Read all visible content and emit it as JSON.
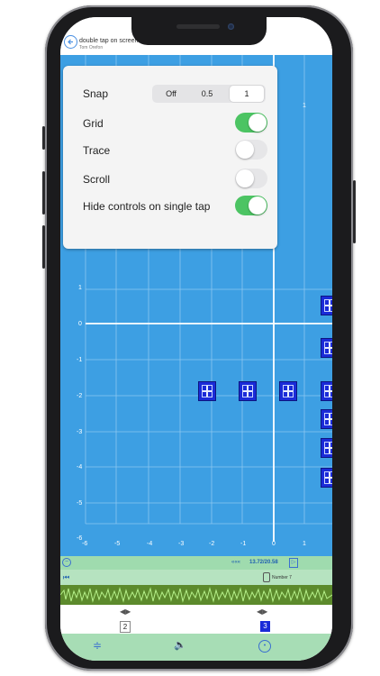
{
  "header": {
    "title": "double tap on screen",
    "subtitle": "Tom Orefon"
  },
  "settings": {
    "snap_label": "Snap",
    "snap_options": [
      "Off",
      "0.5",
      "1"
    ],
    "snap_selected": "1",
    "grid_label": "Grid",
    "grid_on": true,
    "trace_label": "Trace",
    "trace_on": false,
    "scroll_label": "Scroll",
    "scroll_on": false,
    "hide_label": "Hide controls on single tap",
    "hide_on": true
  },
  "plot": {
    "y_ticks": [
      "1",
      "0",
      "-1",
      "-2",
      "-3",
      "-4",
      "-5",
      "-6"
    ],
    "x_ticks": [
      "-6",
      "-5",
      "-4",
      "-3",
      "-2",
      "-1",
      "0",
      "1"
    ],
    "top_tick": "1"
  },
  "playback": {
    "time": "13.72/20.58",
    "rewind": "«««",
    "track_name": "Number 7"
  },
  "timeline": {
    "frame_a": "2",
    "frame_b": "3"
  },
  "colors": {
    "plot_bg": "#3d9fe3",
    "toggle_on": "#4cc463",
    "marker": "#1a2bd8"
  }
}
